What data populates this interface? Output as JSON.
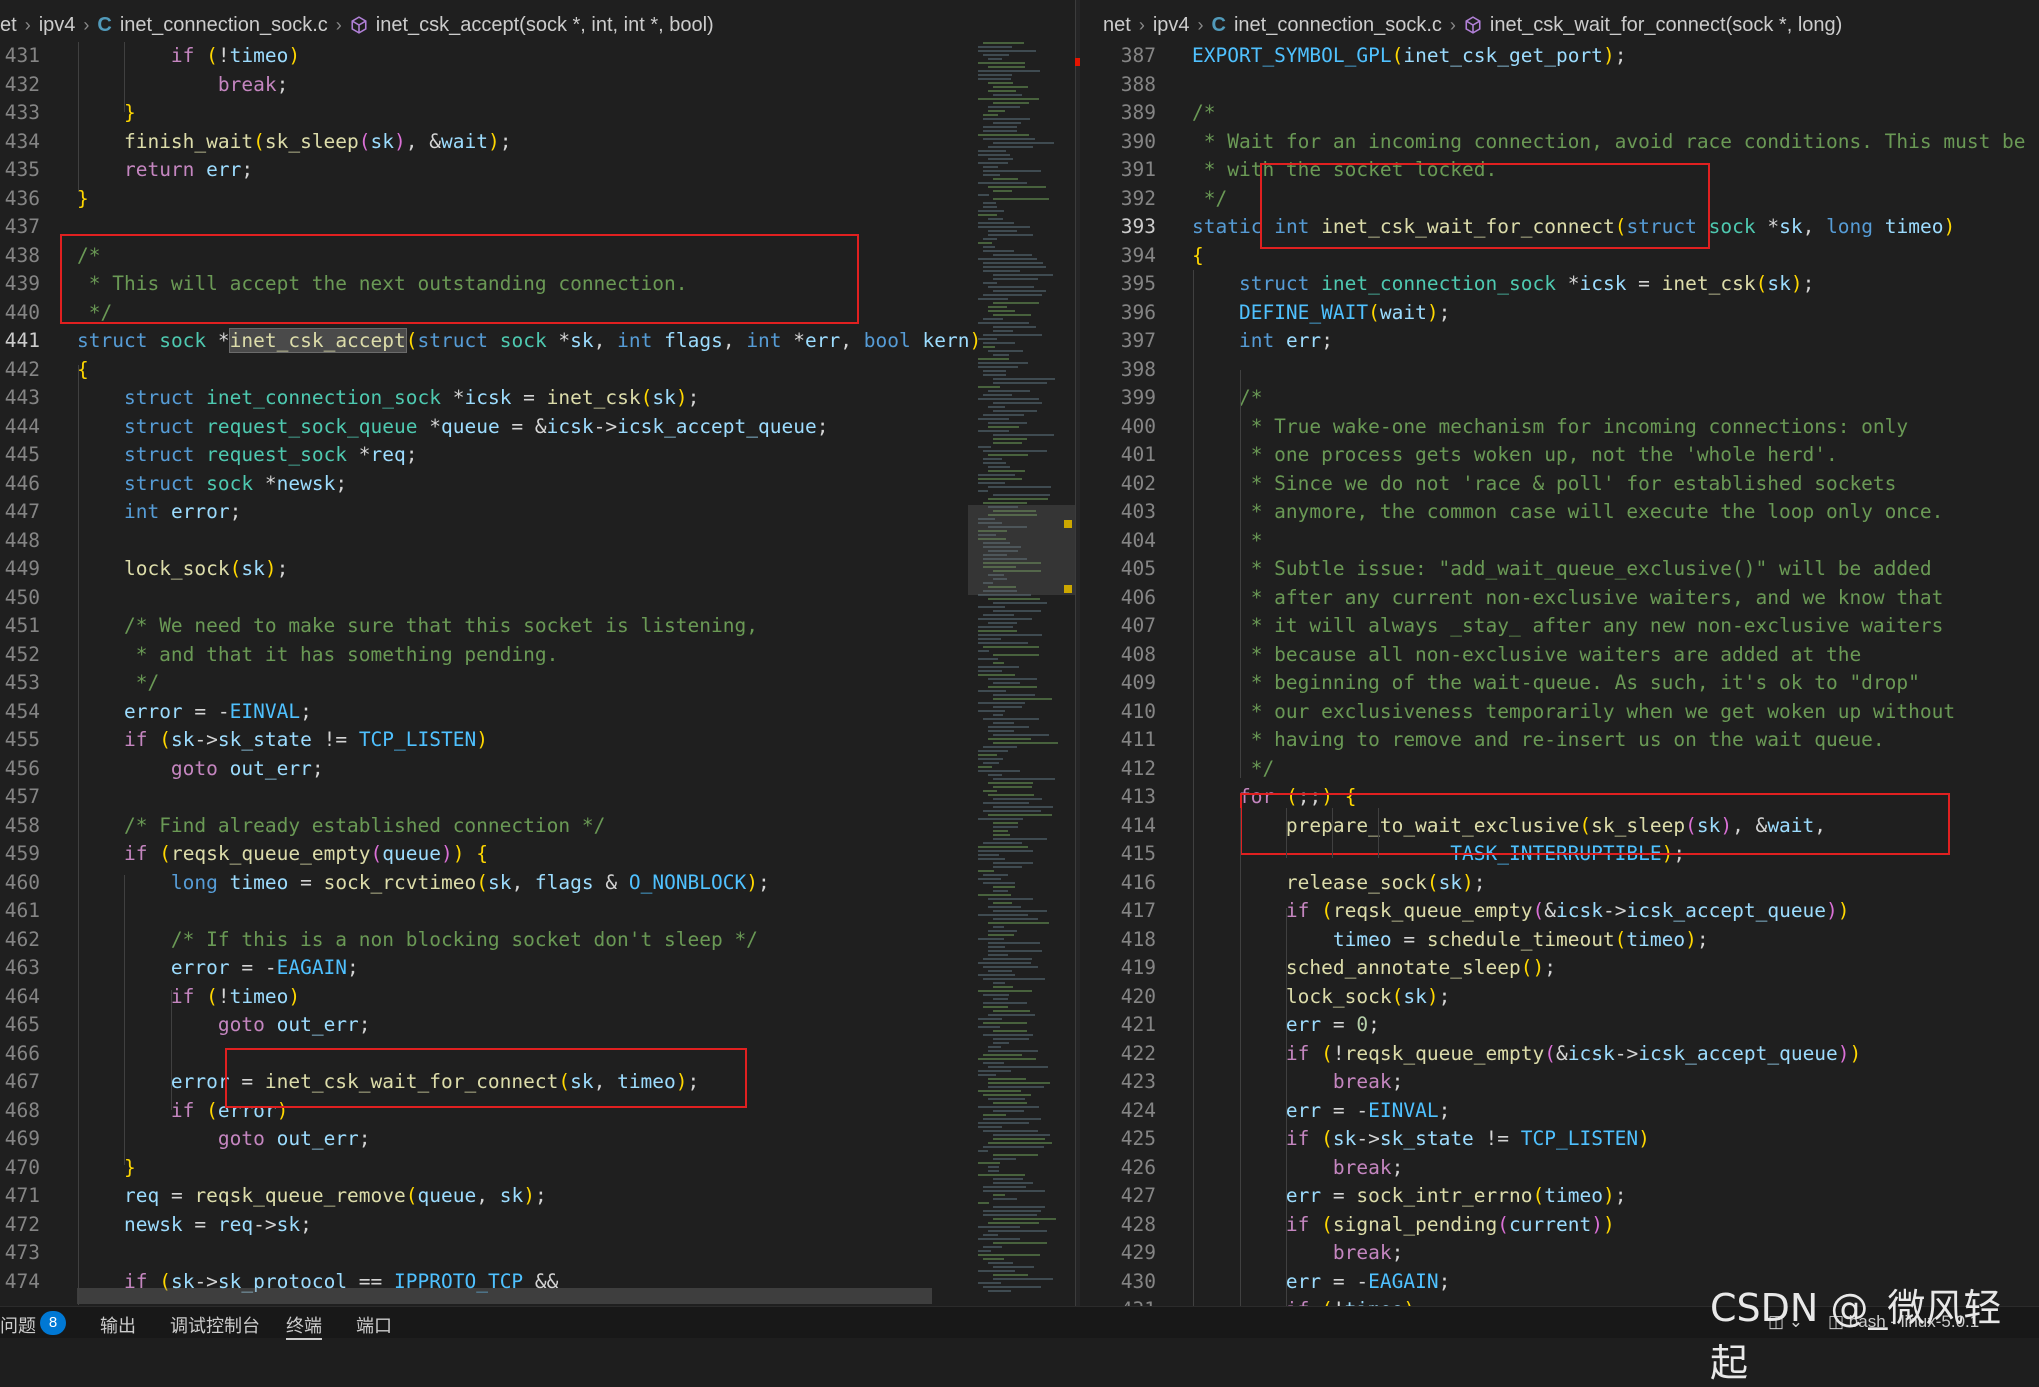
{
  "left": {
    "breadcrumb": [
      "et",
      "ipv4",
      "inet_connection_sock.c",
      "inet_csk_accept(sock *, int, int *, bool)"
    ],
    "lines": [
      {
        "n": "431",
        "code": "        if (!timeo)"
      },
      {
        "n": "432",
        "code": "            break;"
      },
      {
        "n": "433",
        "code": "    }"
      },
      {
        "n": "434",
        "code": "    finish_wait(sk_sleep(sk), &wait);"
      },
      {
        "n": "435",
        "code": "    return err;"
      },
      {
        "n": "436",
        "code": "}"
      },
      {
        "n": "437",
        "code": ""
      },
      {
        "n": "438",
        "code": "/*"
      },
      {
        "n": "439",
        "code": " * This will accept the next outstanding connection."
      },
      {
        "n": "440",
        "code": " */"
      },
      {
        "n": "441",
        "code": "struct sock *inet_csk_accept(struct sock *sk, int flags, int *err, bool kern)"
      },
      {
        "n": "442",
        "code": "{"
      },
      {
        "n": "443",
        "code": "    struct inet_connection_sock *icsk = inet_csk(sk);"
      },
      {
        "n": "444",
        "code": "    struct request_sock_queue *queue = &icsk->icsk_accept_queue;"
      },
      {
        "n": "445",
        "code": "    struct request_sock *req;"
      },
      {
        "n": "446",
        "code": "    struct sock *newsk;"
      },
      {
        "n": "447",
        "code": "    int error;"
      },
      {
        "n": "448",
        "code": ""
      },
      {
        "n": "449",
        "code": "    lock_sock(sk);"
      },
      {
        "n": "450",
        "code": ""
      },
      {
        "n": "451",
        "code": "    /* We need to make sure that this socket is listening,"
      },
      {
        "n": "452",
        "code": "     * and that it has something pending."
      },
      {
        "n": "453",
        "code": "     */"
      },
      {
        "n": "454",
        "code": "    error = -EINVAL;"
      },
      {
        "n": "455",
        "code": "    if (sk->sk_state != TCP_LISTEN)"
      },
      {
        "n": "456",
        "code": "        goto out_err;"
      },
      {
        "n": "457",
        "code": ""
      },
      {
        "n": "458",
        "code": "    /* Find already established connection */"
      },
      {
        "n": "459",
        "code": "    if (reqsk_queue_empty(queue)) {"
      },
      {
        "n": "460",
        "code": "        long timeo = sock_rcvtimeo(sk, flags & O_NONBLOCK);"
      },
      {
        "n": "461",
        "code": ""
      },
      {
        "n": "462",
        "code": "        /* If this is a non blocking socket don't sleep */"
      },
      {
        "n": "463",
        "code": "        error = -EAGAIN;"
      },
      {
        "n": "464",
        "code": "        if (!timeo)"
      },
      {
        "n": "465",
        "code": "            goto out_err;"
      },
      {
        "n": "466",
        "code": ""
      },
      {
        "n": "467",
        "code": "        error = inet_csk_wait_for_connect(sk, timeo);"
      },
      {
        "n": "468",
        "code": "        if (error)"
      },
      {
        "n": "469",
        "code": "            goto out_err;"
      },
      {
        "n": "470",
        "code": "    }"
      },
      {
        "n": "471",
        "code": "    req = reqsk_queue_remove(queue, sk);"
      },
      {
        "n": "472",
        "code": "    newsk = req->sk;"
      },
      {
        "n": "473",
        "code": ""
      },
      {
        "n": "474",
        "code": "    if (sk->sk_protocol == IPPROTO_TCP &&"
      }
    ]
  },
  "right": {
    "breadcrumb": [
      "net",
      "ipv4",
      "inet_connection_sock.c",
      "inet_csk_wait_for_connect(sock *, long)"
    ],
    "lines": [
      {
        "n": "387",
        "code": "EXPORT_SYMBOL_GPL(inet_csk_get_port);"
      },
      {
        "n": "388",
        "code": ""
      },
      {
        "n": "389",
        "code": "/*"
      },
      {
        "n": "390",
        "code": " * Wait for an incoming connection, avoid race conditions. This must be ca"
      },
      {
        "n": "391",
        "code": " * with the socket locked."
      },
      {
        "n": "392",
        "code": " */"
      },
      {
        "n": "393",
        "code": "static int inet_csk_wait_for_connect(struct sock *sk, long timeo)"
      },
      {
        "n": "394",
        "code": "{"
      },
      {
        "n": "395",
        "code": "    struct inet_connection_sock *icsk = inet_csk(sk);"
      },
      {
        "n": "396",
        "code": "    DEFINE_WAIT(wait);"
      },
      {
        "n": "397",
        "code": "    int err;"
      },
      {
        "n": "398",
        "code": ""
      },
      {
        "n": "399",
        "code": "    /*"
      },
      {
        "n": "400",
        "code": "     * True wake-one mechanism for incoming connections: only"
      },
      {
        "n": "401",
        "code": "     * one process gets woken up, not the 'whole herd'."
      },
      {
        "n": "402",
        "code": "     * Since we do not 'race & poll' for established sockets"
      },
      {
        "n": "403",
        "code": "     * anymore, the common case will execute the loop only once."
      },
      {
        "n": "404",
        "code": "     *"
      },
      {
        "n": "405",
        "code": "     * Subtle issue: \"add_wait_queue_exclusive()\" will be added"
      },
      {
        "n": "406",
        "code": "     * after any current non-exclusive waiters, and we know that"
      },
      {
        "n": "407",
        "code": "     * it will always _stay_ after any new non-exclusive waiters"
      },
      {
        "n": "408",
        "code": "     * because all non-exclusive waiters are added at the"
      },
      {
        "n": "409",
        "code": "     * beginning of the wait-queue. As such, it's ok to \"drop\""
      },
      {
        "n": "410",
        "code": "     * our exclusiveness temporarily when we get woken up without"
      },
      {
        "n": "411",
        "code": "     * having to remove and re-insert us on the wait queue."
      },
      {
        "n": "412",
        "code": "     */"
      },
      {
        "n": "413",
        "code": "    for (;;) {"
      },
      {
        "n": "414",
        "code": "        prepare_to_wait_exclusive(sk_sleep(sk), &wait,"
      },
      {
        "n": "415",
        "code": "                      TASK_INTERRUPTIBLE);"
      },
      {
        "n": "416",
        "code": "        release_sock(sk);"
      },
      {
        "n": "417",
        "code": "        if (reqsk_queue_empty(&icsk->icsk_accept_queue))"
      },
      {
        "n": "418",
        "code": "            timeo = schedule_timeout(timeo);"
      },
      {
        "n": "419",
        "code": "        sched_annotate_sleep();"
      },
      {
        "n": "420",
        "code": "        lock_sock(sk);"
      },
      {
        "n": "421",
        "code": "        err = 0;"
      },
      {
        "n": "422",
        "code": "        if (!reqsk_queue_empty(&icsk->icsk_accept_queue))"
      },
      {
        "n": "423",
        "code": "            break;"
      },
      {
        "n": "424",
        "code": "        err = -EINVAL;"
      },
      {
        "n": "425",
        "code": "        if (sk->sk_state != TCP_LISTEN)"
      },
      {
        "n": "426",
        "code": "            break;"
      },
      {
        "n": "427",
        "code": "        err = sock_intr_errno(timeo);"
      },
      {
        "n": "428",
        "code": "        if (signal_pending(current))"
      },
      {
        "n": "429",
        "code": "            break;"
      },
      {
        "n": "430",
        "code": "        err = -EAGAIN;"
      },
      {
        "n": "431",
        "code": "        if (!timeo)"
      }
    ]
  },
  "statusbar": {
    "problems_label": "问题",
    "problems_count": "8",
    "output_label": "输出",
    "debug_console_label": "调试控制台",
    "terminal_label": "终端",
    "ports_label": "端口",
    "terminal_name": "bash - linux-5.0.1"
  },
  "watermark": "CSDN @_微风轻起"
}
